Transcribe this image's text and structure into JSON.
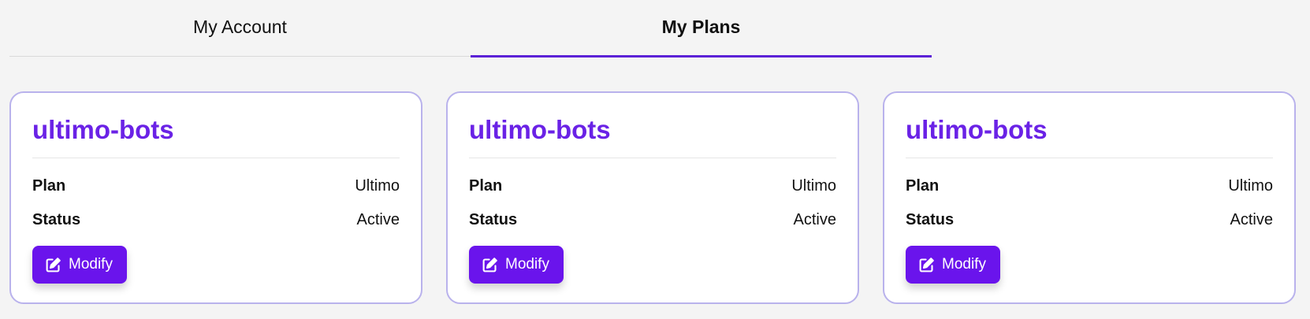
{
  "tabs": [
    {
      "label": "My Account",
      "active": false
    },
    {
      "label": "My Plans",
      "active": true
    }
  ],
  "cards": [
    {
      "title": "ultimo-bots",
      "plan_label": "Plan",
      "plan_value": "Ultimo",
      "status_label": "Status",
      "status_value": "Active",
      "button_label": "Modify",
      "button_icon": "edit-icon"
    },
    {
      "title": "ultimo-bots",
      "plan_label": "Plan",
      "plan_value": "Ultimo",
      "status_label": "Status",
      "status_value": "Active",
      "button_label": "Modify",
      "button_icon": "edit-icon"
    },
    {
      "title": "ultimo-bots",
      "plan_label": "Plan",
      "plan_value": "Ultimo",
      "status_label": "Status",
      "status_value": "Active",
      "button_label": "Modify",
      "button_icon": "edit-icon"
    }
  ],
  "colors": {
    "accent": "#6a14ec",
    "title": "#6a22e6",
    "card_border": "#b9b2ec",
    "background": "#f4f4f4"
  }
}
